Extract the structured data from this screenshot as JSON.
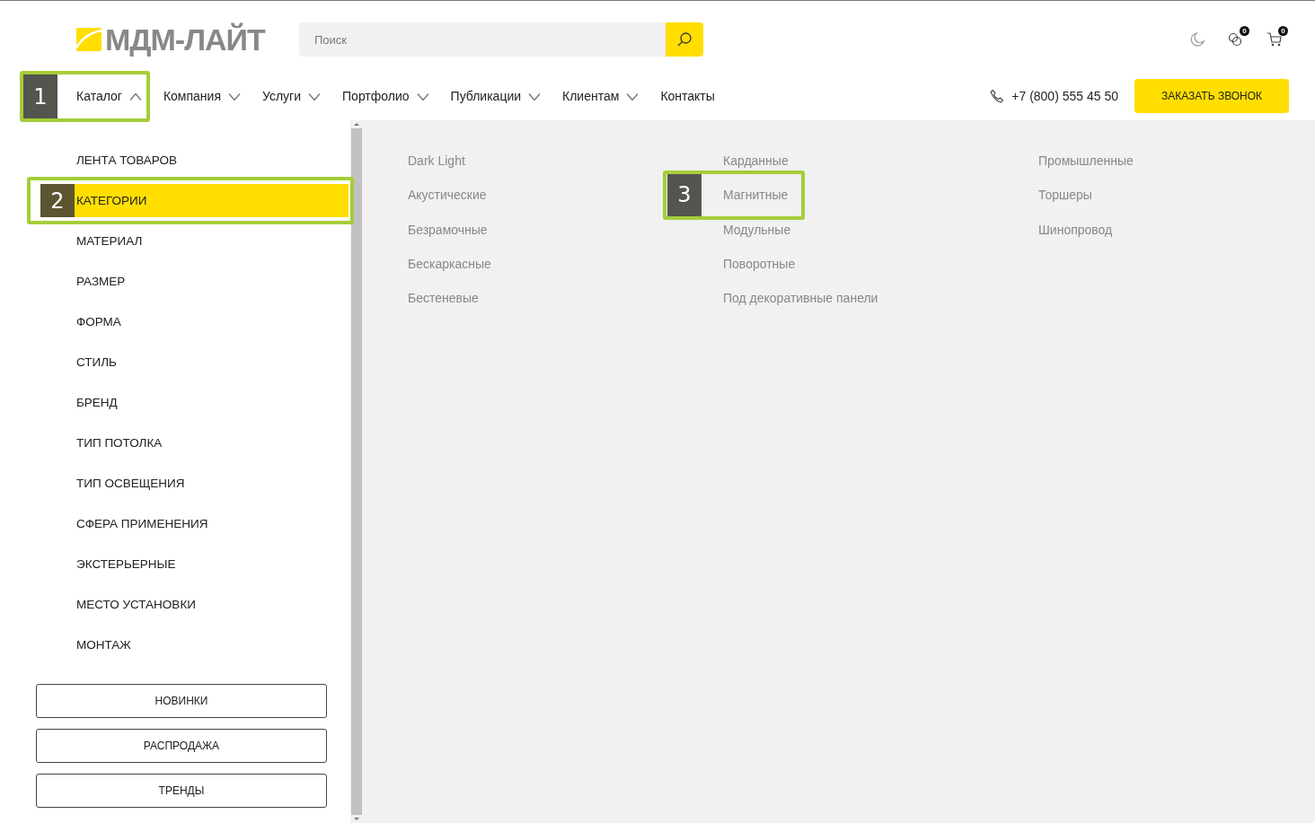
{
  "header": {
    "logo": "МДМ-ЛАЙТ",
    "search": {
      "placeholder": "Поиск"
    },
    "badges": {
      "compare": "0",
      "cart": "0"
    },
    "phone": "+7 (800) 555 45 50",
    "call_button": "ЗАКАЗАТЬ ЗВОНОК"
  },
  "nav": [
    {
      "label": "Каталог",
      "kind": "dropdown",
      "expanded": true,
      "callout": "1"
    },
    {
      "label": "Компания",
      "kind": "dropdown",
      "expanded": false
    },
    {
      "label": "Услуги",
      "kind": "dropdown",
      "expanded": false
    },
    {
      "label": "Портфолио",
      "kind": "dropdown",
      "expanded": false
    },
    {
      "label": "Публикации",
      "kind": "dropdown",
      "expanded": false
    },
    {
      "label": "Клиентам",
      "kind": "dropdown",
      "expanded": false
    },
    {
      "label": "Контакты",
      "kind": "link"
    }
  ],
  "sidebar": {
    "items": [
      {
        "label": "ЛЕНТА ТОВАРОВ",
        "selected": false
      },
      {
        "label": "КАТЕГОРИИ",
        "selected": true,
        "callout": "2"
      },
      {
        "label": "МАТЕРИАЛ",
        "selected": false
      },
      {
        "label": "РАЗМЕР",
        "selected": false
      },
      {
        "label": "ФОРМА",
        "selected": false
      },
      {
        "label": "СТИЛЬ",
        "selected": false
      },
      {
        "label": "БРЕНД",
        "selected": false
      },
      {
        "label": "ТИП ПОТОЛКА",
        "selected": false
      },
      {
        "label": "ТИП ОСВЕЩЕНИЯ",
        "selected": false
      },
      {
        "label": "СФЕРА ПРИМЕНЕНИЯ",
        "selected": false
      },
      {
        "label": "ЭКСТЕРЬЕРНЫЕ",
        "selected": false
      },
      {
        "label": "МЕСТО УСТАНОВКИ",
        "selected": false
      },
      {
        "label": "МОНТАЖ",
        "selected": false
      }
    ],
    "buttons": [
      "НОВИНКИ",
      "РАСПРОДАЖА",
      "ТРЕНДЫ"
    ]
  },
  "categories": [
    [
      {
        "label": "Dark Light"
      },
      {
        "label": "Акустические"
      },
      {
        "label": "Безрамочные"
      },
      {
        "label": "Бескаркасные"
      },
      {
        "label": "Бестеневые"
      }
    ],
    [
      {
        "label": "Карданные"
      },
      {
        "label": "Магнитные",
        "callout": "3"
      },
      {
        "label": "Модульные"
      },
      {
        "label": "Поворотные"
      },
      {
        "label": "Под декоративные панели"
      }
    ],
    [
      {
        "label": "Промышленные"
      },
      {
        "label": "Торшеры"
      },
      {
        "label": "Шинопровод"
      }
    ]
  ]
}
